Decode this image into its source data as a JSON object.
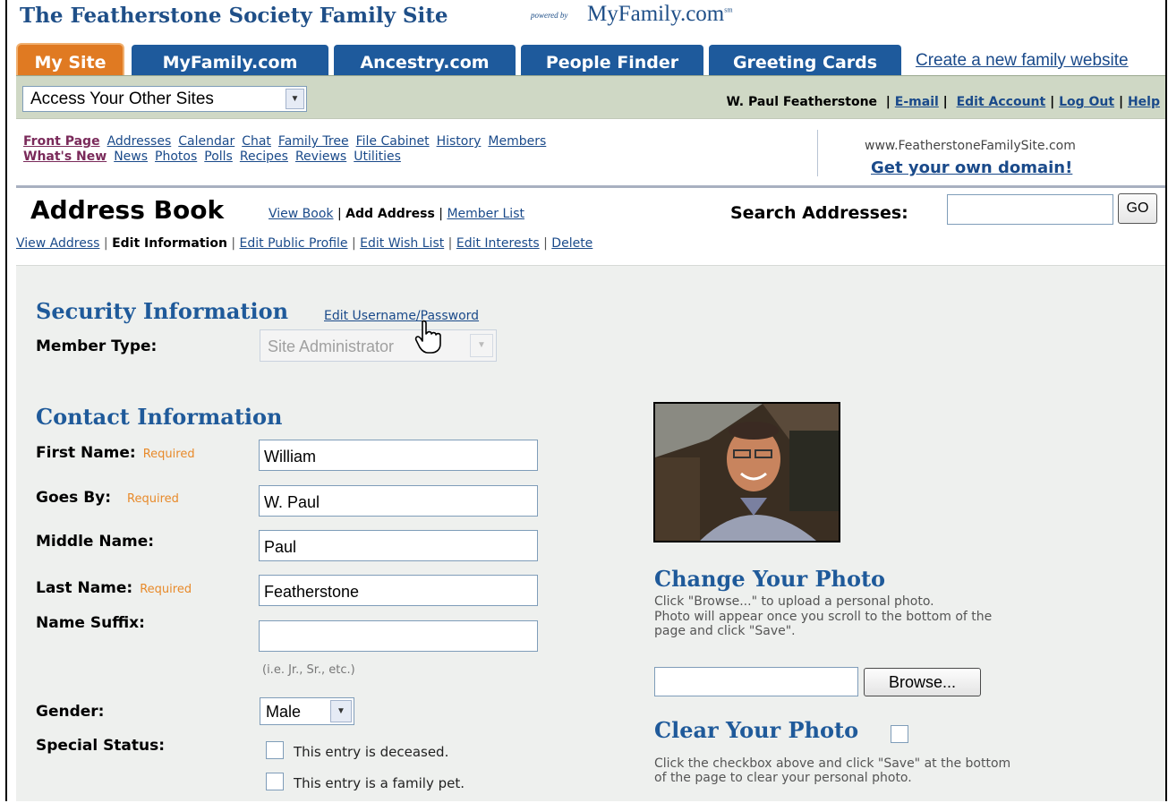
{
  "header": {
    "site_title": "The Featherstone Society Family Site",
    "powered_by": "powered by",
    "brand": "MyFamily.com",
    "brand_mark": "sm"
  },
  "tabs": [
    {
      "label": "My Site",
      "active": true
    },
    {
      "label": "MyFamily.com",
      "active": false
    },
    {
      "label": "Ancestry.com",
      "active": false
    },
    {
      "label": "People Finder",
      "active": false
    },
    {
      "label": "Greeting Cards",
      "active": false
    }
  ],
  "create_link": "Create a new family website",
  "sites_select": {
    "value": "Access Your Other Sites"
  },
  "user": {
    "name": "W. Paul Featherstone",
    "links": [
      "E-mail",
      "Edit Account",
      "Log Out",
      "Help"
    ]
  },
  "nav": {
    "row1": [
      "Front Page",
      "Addresses",
      "Calendar",
      "Chat",
      "Family Tree",
      "File Cabinet",
      "History",
      "Members"
    ],
    "row2": [
      "What's New",
      "News",
      "Photos",
      "Polls",
      "Recipes",
      "Reviews",
      "Utilities"
    ]
  },
  "domain": {
    "url": "www.FeatherstoneFamilySite.com",
    "cta": "Get your own domain!"
  },
  "address_book": {
    "title": "Address Book",
    "links": {
      "view_book": "View Book",
      "add_address": "Add Address",
      "member_list": "Member List"
    },
    "search_label": "Search Addresses:",
    "search_value": "",
    "go": "GO"
  },
  "subnav": {
    "view_address": "View Address",
    "edit_information": "Edit Information",
    "edit_public_profile": "Edit Public Profile",
    "edit_wish_list": "Edit Wish List",
    "edit_interests": "Edit Interests",
    "delete": "Delete"
  },
  "security": {
    "heading": "Security Information",
    "edit_link": "Edit Username/Password",
    "member_type_label": "Member Type:",
    "member_type_value": "Site Administrator"
  },
  "contact": {
    "heading": "Contact Information",
    "required": "Required",
    "first_name_label": "First Name:",
    "first_name": "William",
    "goes_by_label": "Goes By:",
    "goes_by": "W. Paul",
    "middle_name_label": "Middle Name:",
    "middle_name": "Paul",
    "last_name_label": "Last Name:",
    "last_name": "Featherstone",
    "suffix_label": "Name Suffix:",
    "suffix": "",
    "suffix_hint": "(i.e. Jr., Sr., etc.)",
    "gender_label": "Gender:",
    "gender": "Male",
    "special_status_label": "Special Status:",
    "deceased": "This entry is deceased.",
    "pet": "This entry is a family pet."
  },
  "photo": {
    "change_heading": "Change Your Photo",
    "change_desc_1": "Click \"Browse...\" to upload a personal photo.",
    "change_desc_2": "Photo will appear once you scroll to the bottom of the",
    "change_desc_3": "page and click \"Save\".",
    "browse": "Browse...",
    "clear_heading": "Clear Your Photo",
    "clear_desc_1": "Click the checkbox above and click \"Save\" at the bottom",
    "clear_desc_2": "of the page to clear your personal photo."
  }
}
